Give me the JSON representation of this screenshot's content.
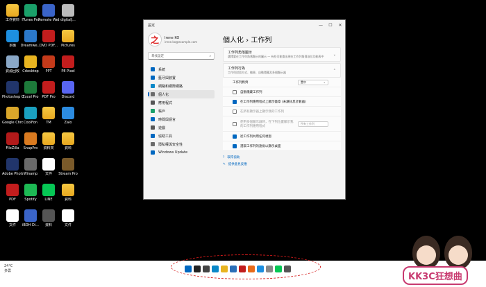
{
  "desktop_icons": [
    {
      "label": "工作資料",
      "color": "folder"
    },
    {
      "label": "ITunes Pro",
      "color": "#1aa06a"
    },
    {
      "label": "Remote Web Host",
      "color": "#3a64c8"
    },
    {
      "label": "digitalJ...",
      "color": "#bbb"
    },
    {
      "label": "本機",
      "color": "#1d8fe0"
    },
    {
      "label": "Dreamwe...",
      "color": "#2b78c9"
    },
    {
      "label": "DVD PDF...",
      "color": "#c21d1d"
    },
    {
      "label": "Pictures",
      "color": "folder"
    },
    {
      "label": "資源回收",
      "color": "#8aa8c7"
    },
    {
      "label": "Cdesktop",
      "color": "#e8b420"
    },
    {
      "label": "PPT",
      "color": "#c43a1a"
    },
    {
      "label": "PE Pixel",
      "color": "#c21d1d"
    },
    {
      "label": "Photoshop CC",
      "color": "#21356b"
    },
    {
      "label": "Excel Pro",
      "color": "#1d7a3a"
    },
    {
      "label": "PDF Pro",
      "color": "#c21d1d"
    },
    {
      "label": "Discord",
      "color": "#5865f2"
    },
    {
      "label": "Google Chrome",
      "color": "#d9a62a"
    },
    {
      "label": "CoolFon",
      "color": "#1aa0c0"
    },
    {
      "label": "TM",
      "color": "folder"
    },
    {
      "label": "Zalo",
      "color": "#2c8be0"
    },
    {
      "label": "FileZilla",
      "color": "#b31a1a"
    },
    {
      "label": "SnapPro",
      "color": "#d97a20"
    },
    {
      "label": "資料夾",
      "color": "folder"
    },
    {
      "label": "資料",
      "color": "folder"
    },
    {
      "label": "Adobe Photosh...",
      "color": "#21356b"
    },
    {
      "label": "Winamp",
      "color": "#6a6a6a"
    },
    {
      "label": "文件",
      "color": "#ffffff"
    },
    {
      "label": "Stream Pro",
      "color": "#7a5a2a"
    },
    {
      "label": "PDF",
      "color": "#c21d1d"
    },
    {
      "label": "Spotify",
      "color": "#1db954"
    },
    {
      "label": "LINE",
      "color": "#06c755"
    },
    {
      "label": "資料",
      "color": "folder"
    },
    {
      "label": "文件",
      "color": "#ffffff"
    },
    {
      "label": "iBDH Di...",
      "color": "#3a64c8"
    },
    {
      "label": "資料",
      "color": "#555"
    },
    {
      "label": "文件",
      "color": "#ffffff"
    }
  ],
  "window": {
    "title": "設定",
    "minimize": "—",
    "maximize": "☐",
    "close": "✕"
  },
  "profile": {
    "name": "Irene KO",
    "email": "irene.ko@example.com",
    "avatar_text": "之"
  },
  "search": {
    "placeholder": "尋找設定"
  },
  "nav": [
    {
      "label": "系統",
      "color": "#0067c0"
    },
    {
      "label": "藍牙與裝置",
      "color": "#0067c0"
    },
    {
      "label": "網路和網際網路",
      "color": "#0a88c8"
    },
    {
      "label": "個人化",
      "color": "#6a6a6a"
    },
    {
      "label": "應用程式",
      "color": "#555"
    },
    {
      "label": "帳戶",
      "color": "#1aa06a"
    },
    {
      "label": "時間與語言",
      "color": "#0067c0"
    },
    {
      "label": "遊戲",
      "color": "#555"
    },
    {
      "label": "協助工具",
      "color": "#0067c0"
    },
    {
      "label": "隱私權與安全性",
      "color": "#6a6a6a"
    },
    {
      "label": "Windows Update",
      "color": "#0067c0"
    }
  ],
  "main": {
    "breadcrumb": "個人化  ›  工作列",
    "card1_title": "工作列角落圖示",
    "card1_sub": "選擇要在工作列角落顯示的圖示 — 有些可能會出現在工作列角落溢位功能表中",
    "card2_title": "工作列行為",
    "card2_sub": "工作列對齊方式、徽章、自動隱藏及多個顯示器",
    "align_label": "工作列對齊",
    "align_value": "置中",
    "options": [
      {
        "label": "自動隱藏工作列",
        "checked": false,
        "dim": false
      },
      {
        "label": "在工作列應用程式上顯示徽章 (未讀訊息計數器)",
        "checked": true,
        "dim": false
      },
      {
        "label": "在所有顯示器上顯示我的工作列",
        "checked": false,
        "dim": true
      },
      {
        "label": "使用多個顯示器時，在下列位置顯示我的工作列應用程式",
        "checked": false,
        "dim": true,
        "dropdown": "所有工作列"
      },
      {
        "label": "從工作列共用任何視窗",
        "checked": true,
        "dim": false
      },
      {
        "label": "選取工作列的遠角以顯示桌面",
        "checked": true,
        "dim": false
      }
    ],
    "help_link": "取得協助",
    "feedback_link": "提供意見反應"
  },
  "taskbar": {
    "weather": "24°C",
    "weather_sub": "多雲",
    "icons": [
      "#0067c0",
      "#222",
      "#444",
      "#0a88c8",
      "#e8b420",
      "#2b6fb8",
      "#c21d1d",
      "#e86a1a",
      "#1d8fe0",
      "#888",
      "#06c755",
      "#555"
    ]
  },
  "watermark": "KK3C狂想曲"
}
